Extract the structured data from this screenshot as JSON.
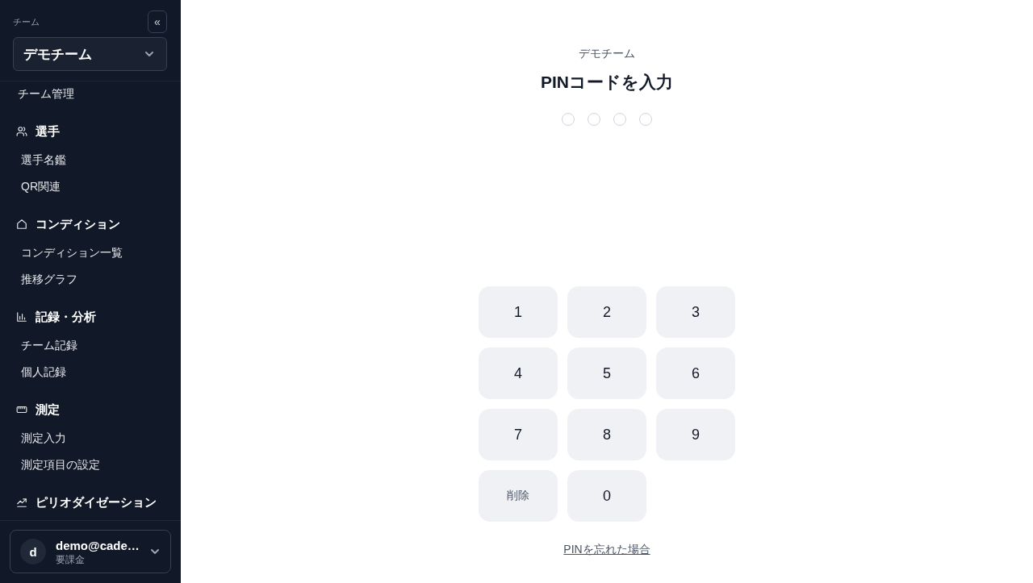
{
  "sidebar": {
    "team_label": "チーム",
    "collapse_button": "«",
    "team_select": {
      "value": "デモチーム"
    },
    "nav": {
      "top_items": [
        {
          "label": "チーム管理",
          "selected": false
        }
      ],
      "sections": [
        {
          "label": "選手",
          "items": [
            {
              "label": "選手名鑑",
              "selected": false
            },
            {
              "label": "QR関連",
              "selected": false
            }
          ]
        },
        {
          "label": "コンディション",
          "items": [
            {
              "label": "コンディション一覧",
              "selected": false
            },
            {
              "label": "推移グラフ",
              "selected": false
            }
          ]
        },
        {
          "label": "記録・分析",
          "items": [
            {
              "label": "チーム記録",
              "selected": false
            },
            {
              "label": "個人記録",
              "selected": false
            }
          ]
        },
        {
          "label": "測定",
          "items": [
            {
              "label": "測定入力",
              "selected": false
            },
            {
              "label": "測定項目の設定",
              "selected": false
            }
          ]
        },
        {
          "label": "ピリオダイゼーション"
        }
      ]
    },
    "account": {
      "avatar_initial": "d",
      "email": "demo@cade…",
      "plan": "要課金"
    }
  },
  "main": {
    "team_name": "デモチーム",
    "title": "PINコードを入力",
    "pin_dots": [
      {
        "filled": false
      },
      {
        "filled": false
      },
      {
        "filled": false
      },
      {
        "filled": false
      }
    ],
    "keypad": [
      {
        "kind": "digit",
        "label": "1"
      },
      {
        "kind": "digit",
        "label": "2"
      },
      {
        "kind": "digit",
        "label": "3"
      },
      {
        "kind": "digit",
        "label": "4"
      },
      {
        "kind": "digit",
        "label": "5"
      },
      {
        "kind": "digit",
        "label": "6"
      },
      {
        "kind": "digit",
        "label": "7"
      },
      {
        "kind": "digit",
        "label": "8"
      },
      {
        "kind": "digit",
        "label": "9"
      },
      {
        "kind": "delete",
        "label": "削除"
      },
      {
        "kind": "digit",
        "label": "0"
      }
    ],
    "forgot_link": "PINを忘れた場合"
  }
}
